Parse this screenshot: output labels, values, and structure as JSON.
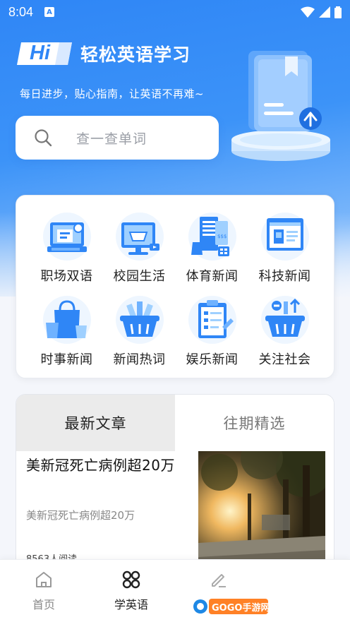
{
  "status_bar": {
    "time": "8:04",
    "notif_letter": "A"
  },
  "header": {
    "logo_text": "Hi",
    "title": "轻松英语学习",
    "slogan": "每日进步，贴心指南，让英语不再难~"
  },
  "search": {
    "placeholder": "查一查单词",
    "icon": "search-icon"
  },
  "categories": [
    {
      "label": "职场双语",
      "icon": "office-icon"
    },
    {
      "label": "校园生活",
      "icon": "campus-icon"
    },
    {
      "label": "体育新闻",
      "icon": "sports-icon"
    },
    {
      "label": "科技新闻",
      "icon": "tech-icon"
    },
    {
      "label": "时事新闻",
      "icon": "current-affairs-icon"
    },
    {
      "label": "新闻热词",
      "icon": "hot-words-icon"
    },
    {
      "label": "娱乐新闻",
      "icon": "entertainment-icon"
    },
    {
      "label": "关注社会",
      "icon": "society-icon"
    }
  ],
  "article_tabs": {
    "active": "最新文章",
    "other": "往期精选"
  },
  "article": {
    "title": "美新冠死亡病例超20万",
    "summary": "美新冠死亡病例超20万",
    "reads": "8563人阅读"
  },
  "bottom_nav": [
    {
      "label": "首页",
      "icon": "home-icon",
      "active": false
    },
    {
      "label": "学英语",
      "icon": "grid-icon",
      "active": true
    },
    {
      "label": "",
      "icon": "edit-icon",
      "active": false
    },
    {
      "label": "",
      "icon": "profile-icon",
      "active": false
    }
  ],
  "watermark": {
    "text": "GOGO手游网"
  },
  "colors": {
    "primary": "#2f86f6",
    "accent": "#3c93f8"
  }
}
